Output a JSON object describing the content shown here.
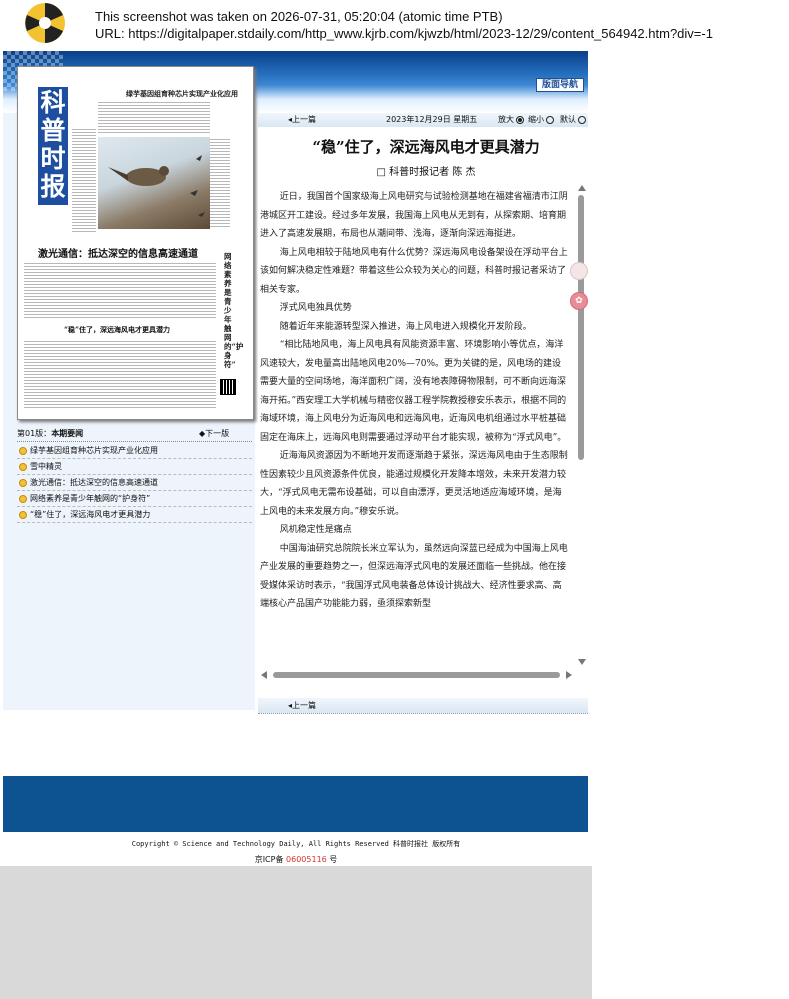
{
  "capture": {
    "line1": "This screenshot was taken on 2026-07-31, 05:20:04 (atomic time PTB)",
    "line2": "URL: https://digitalpaper.stdaily.com/http_www.kjrb.com/kjwzb/html/2023-12/29/content_564942.htm?div=-1"
  },
  "banner": {
    "nav_label": "版面导航"
  },
  "thumbnail": {
    "paper_name": "科普时报",
    "headline_top": "绿芋基因组育种芯片实现产业化应用",
    "headline_mid": "激光通信：抵达深空的信息高速通道",
    "headline_bottom": "“稳”住了，深远海风电才更具潜力",
    "vertical_text": "网络素养是青少年触网的“护身符”",
    "photo_caption": "雪中精灵"
  },
  "page_nav": {
    "page_label_prefix": "第01版：",
    "page_label": "本期要闻",
    "next_label": "下一版"
  },
  "article_list": [
    "绿芋基因组育种芯片实现产业化应用",
    "雪中精灵",
    "激光通信：抵达深空的信息高速通道",
    "网络素养是青少年触网的“护身符”",
    "“稳”住了，深远海风电才更具潜力"
  ],
  "toolbar": {
    "prev_label": "上一篇",
    "date": "2023年12月29日 星期五",
    "zoom_in": "放大",
    "zoom_out": "缩小",
    "default": "默认"
  },
  "article": {
    "title": "“稳”住了，深远海风电才更具潜力",
    "author": "科普时报记者 陈 杰",
    "paragraphs": [
      "近日，我国首个国家级海上风电研究与试验检测基地在福建省福清市江阴港城区开工建设。经过多年发展，我国海上风电从无到有，从探索期、培育期进入了高速发展期，布局也从潮间带、浅海，逐渐向深远海挺进。",
      "海上风电相较于陆地风电有什么优势？深远海风电设备架设在浮动平台上该如何解决稳定性难题？带着这些公众较为关心的问题，科普时报记者采访了相关专家。",
      "浮式风电独具优势",
      "随着近年来能源转型深入推进，海上风电进入规模化开发阶段。",
      "“相比陆地风电，海上风电具有风能资源丰富、环境影响小等优点，海洋风速较大，发电量高出陆地风电20%—70%。更为关键的是，风电场的建设需要大量的空间场地，海洋面积广阔，没有地表障碍物限制，可不断向远海深海开拓。”西安理工大学机械与精密仪器工程学院教授穆安乐表示，根据不同的海域环境，海上风电分为近海风电和远海风电，近海风电机组通过水平桩基础固定在海床上，远海风电则需要通过浮动平台才能实现，被称为“浮式风电”。",
      "近海海风资源因为不断地开发而逐渐趋于紧张，深远海风电由于生态限制性因素较少且风资源条件优良，能通过规模化开发降本增效，未来开发潜力较大，“浮式风电无需布设基础，可以自由漂浮，更灵活地适应海域环境，是海上风电的未来发展方向。”穆安乐说。",
      "风机稳定性是痛点",
      "中国海油研究总院院长米立军认为，虽然远向深蓝已经成为中国海上风电产业发展的重要趋势之一，但深远海浮式风电的发展还面临一些挑战。他在接受媒体采访时表示，“我国浮式风电装备总体设计挑战大、经济性要求高、高端核心产品国产功能能力弱，亟须探索新型"
    ]
  },
  "bottom_nav": {
    "prev_label": "上一篇"
  },
  "footer": {
    "copyright": "Copyright © Science and Technology Daily, All Rights Reserved 科普时报社 版权所有",
    "icp_prefix": "京ICP备",
    "icp_number": "06005116",
    "icp_suffix": "号"
  },
  "colors": {
    "banner_blue": "#0b3f87",
    "footer_blue": "#0d5291",
    "icp_red": "#d9342b",
    "bullet": "#f1c232"
  }
}
